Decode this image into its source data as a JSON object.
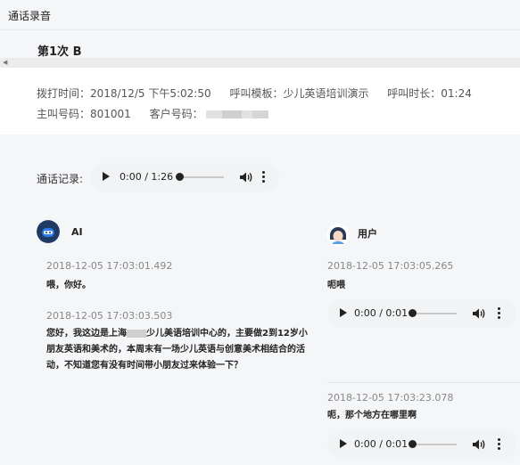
{
  "panel": {
    "title": "通话录音"
  },
  "tab": {
    "label": "第1次 B"
  },
  "info": {
    "dial_time": "拨打时间：2018/12/5 下午5:02:50",
    "template": "呼叫模板：少儿英语培训演示",
    "duration": "呼叫时长：01:24",
    "caller": "主叫号码：801001",
    "customer_label": "客户号码："
  },
  "recording": {
    "label": "通话记录:",
    "time": "0:00 / 1:26",
    "progress": 0.0
  },
  "ai": {
    "name": "AI",
    "messages": [
      {
        "timestamp": "2018-12-05 17:03:01.492",
        "text": "喂，你好。"
      },
      {
        "timestamp": "2018-12-05 17:03:03.503",
        "line1_before": "您好，我这边是上海",
        "line1_after": "少儿美语培训中心的，主要做2到12岁小",
        "line2": "朋友英语和美术的，本周末有一场少儿英语与创意美术相结合的活",
        "line3": "动，不知道您有没有时间带小朋友过来体验一下？"
      }
    ]
  },
  "user": {
    "name": "用户",
    "messages": [
      {
        "timestamp": "2018-12-05 17:03:05.265",
        "text": "呃喂",
        "audio_time": "0:00 / 0:01",
        "progress": 0.0
      },
      {
        "timestamp": "2018-12-05 17:03:23.078",
        "text": "呃，那个地方在哪里啊",
        "audio_time": "0:00 / 0:01",
        "progress": 0.0
      }
    ]
  },
  "colors": {
    "accent": "#1e6fd9",
    "ai_avatar": "#1f3a63",
    "user_avatar": "#2a3a55"
  },
  "icons": [
    "play-icon",
    "volume-icon",
    "more-options-icon",
    "ai-avatar-icon",
    "user-avatar-icon"
  ]
}
